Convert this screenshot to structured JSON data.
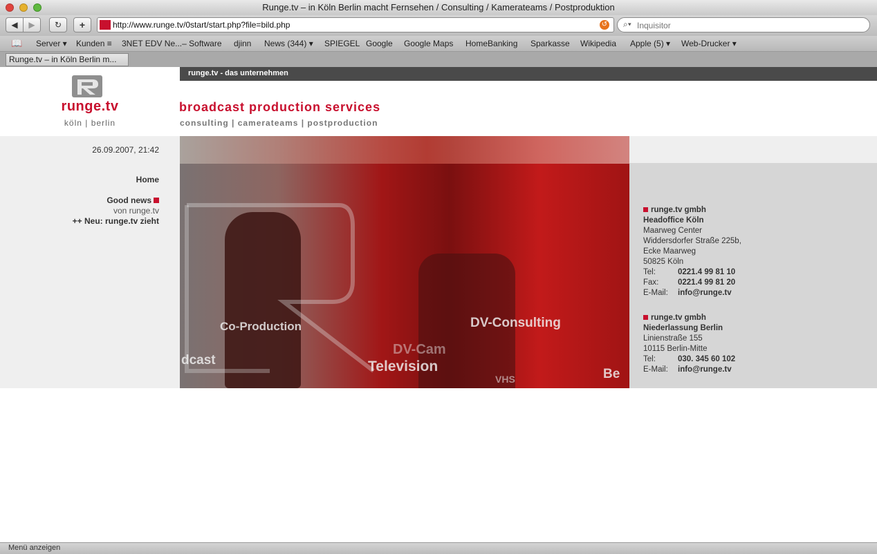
{
  "window": {
    "title": "Runge.tv – in Köln Berlin macht Fernsehen / Consulting / Kamerateams / Postproduktion"
  },
  "toolbar": {
    "back_label": "◀",
    "forward_label": "▶",
    "reload_label": "↻",
    "add_label": "+",
    "url": "http://www.runge.tv/0start/start.php?file=bild.php",
    "search_placeholder": "Inquisitor"
  },
  "bookmarks": [
    {
      "label": "Server ▾"
    },
    {
      "label": "Kunden ≡"
    },
    {
      "label": "3NET EDV Ne...– Software"
    },
    {
      "label": "djinn"
    },
    {
      "label": "News (344) ▾"
    },
    {
      "label": "SPIEGEL"
    },
    {
      "label": "Google"
    },
    {
      "label": "Google Maps"
    },
    {
      "label": "HomeBanking"
    },
    {
      "label": "Sparkasse"
    },
    {
      "label": "Wikipedia"
    },
    {
      "label": "Apple (5) ▾"
    },
    {
      "label": "Web-Drucker ▾"
    }
  ],
  "tab": {
    "label": "Runge.tv – in Köln Berlin m..."
  },
  "page": {
    "strip_label": "runge.tv - das unternehmen",
    "logo_text": "runge.tv",
    "logo_sub": "köln | berlin",
    "headline": "broadcast production services",
    "subline": "consulting   |   camerateams   |   postproduction",
    "datetime": "26.09.2007, 21:42",
    "nav": {
      "home": "Home",
      "good_news": "Good news",
      "good_news_sub": "von runge.tv",
      "ticker": "++ Neu: runge.tv zieht"
    },
    "hero_words": [
      "Co-Production",
      "DV-Consulting",
      "DV-Cam",
      "Television",
      "dcast",
      "VHS",
      "Be"
    ],
    "koeln": {
      "company": "runge.tv gmbh",
      "office": "Headoffice Köln",
      "line1": "Maarweg Center",
      "line2": "Widdersdorfer Straße 225b,",
      "line3": "Ecke Maarweg",
      "line4": "50825 Köln",
      "tel_label": "Tel:",
      "tel": "0221.4 99 81 10",
      "fax_label": "Fax:",
      "fax": "0221.4 99 81 20",
      "mail_label": "E-Mail:",
      "mail": "info@runge.tv"
    },
    "berlin": {
      "company": "runge.tv gmbh",
      "office": "Niederlassung Berlin",
      "line1": "Linienstraße 155",
      "line2": "10115 Berlin-Mitte",
      "tel_label": "Tel:",
      "tel": "030. 345 60 102",
      "mail_label": "E-Mail:",
      "mail": "info@runge.tv"
    }
  },
  "status": {
    "text": "Menü anzeigen"
  },
  "colors": {
    "brand_red": "#c8102e",
    "strip_dark": "#4a4a4a"
  }
}
